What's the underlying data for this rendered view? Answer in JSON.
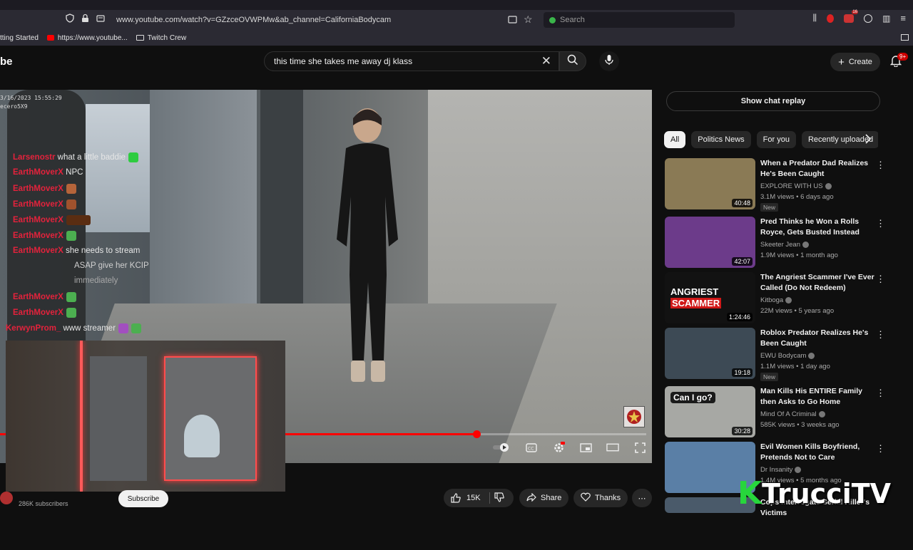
{
  "browser": {
    "url": "www.youtube.com/watch?v=GZzceOVWPMw&ab_channel=CaliforniaBodycam",
    "search_placeholder": "Search",
    "ext_badge": "16",
    "bookmarks": [
      {
        "label": "tting Started"
      },
      {
        "label": "https://www.youtube..."
      },
      {
        "label": "Twitch Crew"
      }
    ]
  },
  "header": {
    "logo_fragment": "be",
    "search_query": "this time she takes me away dj klass",
    "create_label": "Create",
    "notif_badge": "9+"
  },
  "video": {
    "timestamp_line1": "3/16/2023 15:55:29",
    "timestamp_line2": "ecero5X9",
    "progress_fraction": 0.53,
    "channel_subscribers": "286K subscribers",
    "subscribe_label": "Subscribe",
    "likes": "15K",
    "share_label": "Share",
    "thanks_label": "Thanks"
  },
  "chat": [
    {
      "user": "Larsenostr",
      "msg": "what a little baddie"
    },
    {
      "user": "EarthMoverX",
      "msg": "NPC"
    },
    {
      "user": "EarthMoverX",
      "msg": ""
    },
    {
      "user": "EarthMoverX",
      "msg": ""
    },
    {
      "user": "EarthMoverX",
      "msg": ""
    },
    {
      "user": "EarthMoverX",
      "msg": ""
    },
    {
      "user": "EarthMoverX",
      "msg": "she needs to stream"
    },
    {
      "user": "",
      "msg": "ASAP give her KCIP"
    },
    {
      "user": "",
      "msg": "immediately"
    },
    {
      "user": "EarthMoverX",
      "msg": ""
    },
    {
      "user": "EarthMoverX",
      "msg": ""
    },
    {
      "user": "KerwynProm_",
      "msg": "www streamer"
    }
  ],
  "sidebar": {
    "chat_replay_label": "Show chat replay",
    "chips": [
      "All",
      "Politics News",
      "For you",
      "Recently uploaded"
    ],
    "recommendations": [
      {
        "title": "When a Predator Dad Realizes He's Been Caught",
        "channel": "EXPLORE WITH US",
        "meta": "3.1M views • 6 days ago",
        "duration": "40:48",
        "badge": "New",
        "thumb_color": "#8a7a55"
      },
      {
        "title": "Pred Thinks he Won a Rolls Royce, Gets Busted Instead",
        "channel": "Skeeter Jean",
        "meta": "1.9M views • 1 month ago",
        "duration": "42:07",
        "badge": "",
        "thumb_color": "#6c3b8a"
      },
      {
        "title": "The Angriest Scammer I've Ever Called (Do Not Redeem)",
        "channel": "Kitboga",
        "meta": "22M views • 5 years ago",
        "duration": "1:24:46",
        "badge": "",
        "thumb_color": "#121212",
        "thumb_text1": "ANGRIEST",
        "thumb_text2": "SCAMMER"
      },
      {
        "title": "Roblox Predator Realizes He's Been Caught",
        "channel": "EWU Bodycam",
        "meta": "1.1M views • 1 day ago",
        "duration": "19:18",
        "badge": "New",
        "thumb_color": "#3d4a55"
      },
      {
        "title": "Man Kills His ENTIRE Family then Asks to Go Home",
        "channel": "Mind Of A Criminal",
        "meta": "585K views • 3 weeks ago",
        "duration": "30:28",
        "badge": "",
        "thumb_color": "#a7a8a4",
        "thumb_text1": "Can I go?"
      },
      {
        "title": "Evil Women Kills Boyfriend, Pretends Not to Care",
        "channel": "Dr Insanity",
        "meta": "1.4M views • 5 months ago",
        "duration": "",
        "badge": "",
        "thumb_color": "#5a7fa6"
      },
      {
        "title": "Cops Interrogate Serial Killer's Victims",
        "channel": "",
        "meta": "",
        "duration": "",
        "badge": "",
        "thumb_color": "#4a5a6a"
      }
    ]
  },
  "watermark": {
    "k": "K",
    "text": "TrucciTV"
  },
  "colors": {
    "accent": "#ff0000",
    "chat_user": "#e4223c",
    "watermark_green": "#27d63c"
  }
}
